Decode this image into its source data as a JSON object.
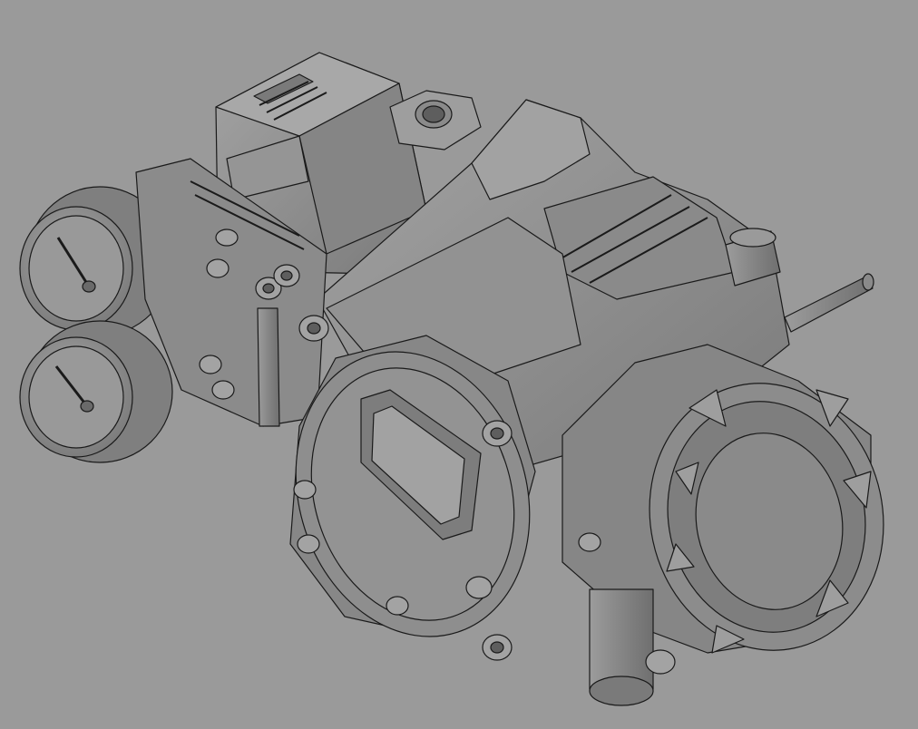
{
  "scene": {
    "background": "#9a9a9a",
    "body_fill": "#8d8d8d",
    "face_fill": "#7e7e7e",
    "shadow_fill": "#6c6c6c",
    "highlight_fill": "#b4b4b4",
    "edge_color": "#1a1a1a"
  }
}
